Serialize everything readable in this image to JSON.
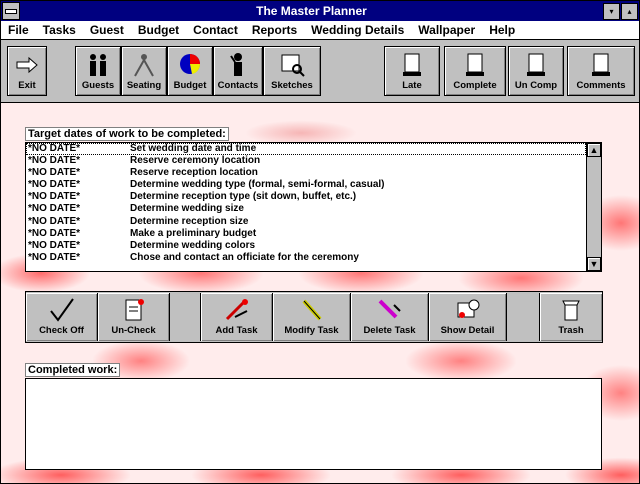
{
  "window": {
    "title": "The Master Planner",
    "min_btn": "▾",
    "max_btn": "▴"
  },
  "menu": [
    {
      "label": "File"
    },
    {
      "label": "Tasks"
    },
    {
      "label": "Guest"
    },
    {
      "label": "Budget"
    },
    {
      "label": "Contact"
    },
    {
      "label": "Reports"
    },
    {
      "label": "Wedding Details"
    },
    {
      "label": "Wallpaper"
    },
    {
      "label": "Help"
    }
  ],
  "toolbar": {
    "exit": "Exit",
    "guests": "Guests",
    "seating": "Seating",
    "budget": "Budget",
    "contacts": "Contacts",
    "sketches": "Sketches",
    "late": "Late",
    "complete": "Complete",
    "uncomp": "Un Comp",
    "comments": "Comments"
  },
  "tasks": {
    "label": "Target dates of work to be completed:",
    "rows": [
      {
        "date": "*NO DATE*",
        "task": "Set wedding date and time"
      },
      {
        "date": "*NO DATE*",
        "task": "Reserve ceremony location"
      },
      {
        "date": "*NO DATE*",
        "task": "Reserve reception location"
      },
      {
        "date": "*NO DATE*",
        "task": "Determine wedding type (formal, semi-formal, casual)"
      },
      {
        "date": "*NO DATE*",
        "task": "Determine reception type (sit down, buffet, etc.)"
      },
      {
        "date": "*NO DATE*",
        "task": "Determine wedding size"
      },
      {
        "date": "*NO DATE*",
        "task": "Determine reception size"
      },
      {
        "date": "*NO DATE*",
        "task": "Make a preliminary budget"
      },
      {
        "date": "*NO DATE*",
        "task": "Determine wedding colors"
      },
      {
        "date": "*NO DATE*",
        "task": "Chose and contact an officiate for the ceremony"
      }
    ],
    "scroll_up": "▲",
    "scroll_down": "▼"
  },
  "actions": {
    "check_off": "Check Off",
    "uncheck": "Un-Check",
    "add_task": "Add Task",
    "modify_task": "Modify Task",
    "delete_task": "Delete Task",
    "show_detail": "Show Detail",
    "trash": "Trash"
  },
  "completed": {
    "label": "Completed work:"
  },
  "colors": {
    "title_bar": "#000080",
    "wallpaper": "#ff0000"
  }
}
